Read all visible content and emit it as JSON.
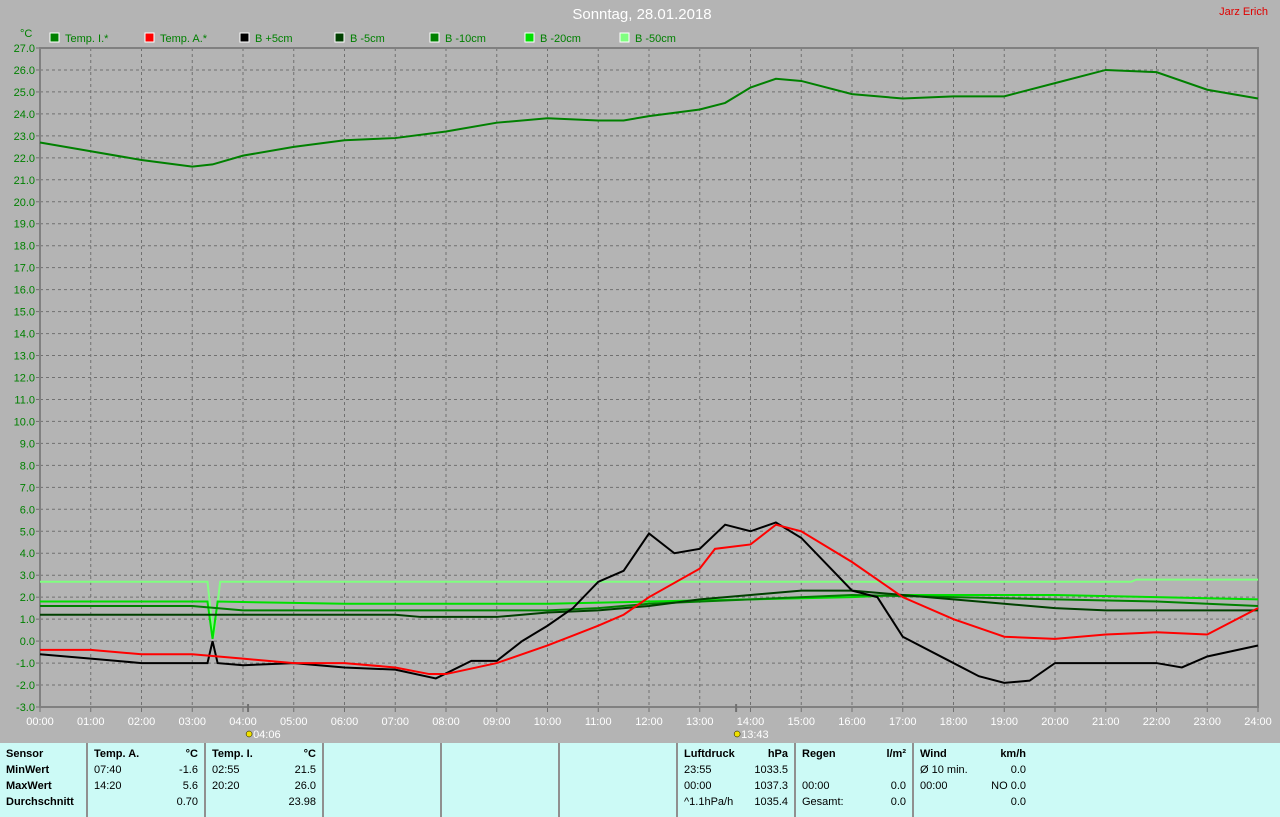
{
  "header": {
    "title": "Sonntag, 28.01.2018",
    "author": "Jarz Erich"
  },
  "chart_data": {
    "type": "line",
    "title": "Sonntag, 28.01.2018",
    "ylabel": "°C",
    "ylim": [
      -3,
      27
    ],
    "xlim": [
      0,
      24
    ],
    "grid": true,
    "legend_position": "top",
    "xticks": [
      "00:00",
      "01:00",
      "02:00",
      "03:00",
      "04:00",
      "05:00",
      "06:00",
      "07:00",
      "08:00",
      "09:00",
      "10:00",
      "11:00",
      "12:00",
      "13:00",
      "14:00",
      "15:00",
      "16:00",
      "17:00",
      "18:00",
      "19:00",
      "20:00",
      "21:00",
      "22:00",
      "23:00",
      "24:00"
    ],
    "yticks": [
      "27.0",
      "26.0",
      "25.0",
      "24.0",
      "23.0",
      "22.0",
      "21.0",
      "20.0",
      "19.0",
      "18.0",
      "17.0",
      "16.0",
      "15.0",
      "14.0",
      "13.0",
      "12.0",
      "11.0",
      "10.0",
      "9.0",
      "8.0",
      "7.0",
      "6.0",
      "5.0",
      "4.0",
      "3.0",
      "2.0",
      "1.0",
      "0.0",
      "-1.0",
      "-2.0",
      "-3.0"
    ],
    "sunrise": "04:06",
    "sunset": "13:43",
    "series": [
      {
        "name": "Temp. I.*",
        "color": "#008000",
        "points": [
          [
            0,
            22.7
          ],
          [
            1,
            22.3
          ],
          [
            2,
            21.9
          ],
          [
            3,
            21.6
          ],
          [
            3.4,
            21.7
          ],
          [
            4,
            22.1
          ],
          [
            5,
            22.5
          ],
          [
            6,
            22.8
          ],
          [
            7,
            22.9
          ],
          [
            8,
            23.2
          ],
          [
            9,
            23.6
          ],
          [
            10,
            23.8
          ],
          [
            11,
            23.7
          ],
          [
            11.5,
            23.7
          ],
          [
            12,
            23.9
          ],
          [
            13,
            24.2
          ],
          [
            13.5,
            24.5
          ],
          [
            14,
            25.2
          ],
          [
            14.5,
            25.6
          ],
          [
            15,
            25.5
          ],
          [
            16,
            24.9
          ],
          [
            17,
            24.7
          ],
          [
            18,
            24.8
          ],
          [
            19,
            24.8
          ],
          [
            20,
            25.4
          ],
          [
            21,
            26.0
          ],
          [
            22,
            25.9
          ],
          [
            23,
            25.1
          ],
          [
            24,
            24.7
          ]
        ]
      },
      {
        "name": "Temp. A.*",
        "color": "#ff0000",
        "points": [
          [
            0,
            -0.4
          ],
          [
            1,
            -0.4
          ],
          [
            2,
            -0.6
          ],
          [
            3,
            -0.6
          ],
          [
            4,
            -0.8
          ],
          [
            5,
            -1.0
          ],
          [
            6,
            -1.0
          ],
          [
            7,
            -1.2
          ],
          [
            7.67,
            -1.5
          ],
          [
            8,
            -1.5
          ],
          [
            9,
            -1.0
          ],
          [
            10,
            -0.2
          ],
          [
            11,
            0.7
          ],
          [
            11.5,
            1.2
          ],
          [
            12,
            2.0
          ],
          [
            13,
            3.3
          ],
          [
            13.3,
            4.2
          ],
          [
            14,
            4.4
          ],
          [
            14.5,
            5.3
          ],
          [
            15,
            5.0
          ],
          [
            16,
            3.6
          ],
          [
            17,
            2.0
          ],
          [
            18,
            1.0
          ],
          [
            19,
            0.2
          ],
          [
            20,
            0.1
          ],
          [
            21,
            0.3
          ],
          [
            22,
            0.4
          ],
          [
            23,
            0.3
          ],
          [
            24,
            1.5
          ]
        ]
      },
      {
        "name": "B +5cm",
        "color": "#000000",
        "points": [
          [
            0,
            -0.6
          ],
          [
            1,
            -0.8
          ],
          [
            2,
            -1.0
          ],
          [
            3,
            -1.0
          ],
          [
            3.3,
            -1.0
          ],
          [
            3.4,
            0.0
          ],
          [
            3.5,
            -1.0
          ],
          [
            4,
            -1.1
          ],
          [
            5,
            -1.0
          ],
          [
            6,
            -1.2
          ],
          [
            7,
            -1.3
          ],
          [
            7.8,
            -1.7
          ],
          [
            8.5,
            -0.9
          ],
          [
            9,
            -0.9
          ],
          [
            9.5,
            0.0
          ],
          [
            10,
            0.7
          ],
          [
            10.5,
            1.5
          ],
          [
            11,
            2.7
          ],
          [
            11.5,
            3.2
          ],
          [
            12,
            4.9
          ],
          [
            12.5,
            4.0
          ],
          [
            13,
            4.2
          ],
          [
            13.5,
            5.3
          ],
          [
            14,
            5.0
          ],
          [
            14.5,
            5.4
          ],
          [
            15,
            4.7
          ],
          [
            15.5,
            3.5
          ],
          [
            16,
            2.3
          ],
          [
            16.5,
            2.0
          ],
          [
            17,
            0.2
          ],
          [
            18,
            -1.0
          ],
          [
            18.5,
            -1.6
          ],
          [
            19,
            -1.9
          ],
          [
            19.5,
            -1.8
          ],
          [
            20,
            -1.0
          ],
          [
            21,
            -1.0
          ],
          [
            22,
            -1.0
          ],
          [
            22.5,
            -1.2
          ],
          [
            23,
            -0.7
          ],
          [
            24,
            -0.2
          ]
        ]
      },
      {
        "name": "B -5cm",
        "color": "#004000",
        "points": [
          [
            0,
            1.2
          ],
          [
            7,
            1.2
          ],
          [
            7.5,
            1.1
          ],
          [
            9,
            1.1
          ],
          [
            10,
            1.3
          ],
          [
            11,
            1.4
          ],
          [
            12,
            1.6
          ],
          [
            13,
            1.9
          ],
          [
            14,
            2.1
          ],
          [
            15,
            2.3
          ],
          [
            16,
            2.3
          ],
          [
            17,
            2.1
          ],
          [
            18,
            1.9
          ],
          [
            19,
            1.7
          ],
          [
            20,
            1.5
          ],
          [
            21,
            1.4
          ],
          [
            24,
            1.4
          ]
        ]
      },
      {
        "name": "B -10cm",
        "color": "#008000",
        "points": [
          [
            0,
            1.6
          ],
          [
            3,
            1.6
          ],
          [
            4,
            1.4
          ],
          [
            10,
            1.4
          ],
          [
            11,
            1.5
          ],
          [
            12,
            1.7
          ],
          [
            14,
            1.9
          ],
          [
            16,
            2.1
          ],
          [
            18,
            2.0
          ],
          [
            20,
            1.9
          ],
          [
            22,
            1.8
          ],
          [
            24,
            1.6
          ]
        ]
      },
      {
        "name": "B -20cm",
        "color": "#00e000",
        "points": [
          [
            0,
            1.8
          ],
          [
            3.3,
            1.8
          ],
          [
            3.4,
            0.1
          ],
          [
            3.5,
            1.8
          ],
          [
            6,
            1.7
          ],
          [
            10,
            1.7
          ],
          [
            12,
            1.8
          ],
          [
            14,
            1.9
          ],
          [
            16,
            2.0
          ],
          [
            17,
            2.1
          ],
          [
            20,
            2.1
          ],
          [
            22,
            2.0
          ],
          [
            24,
            1.9
          ]
        ]
      },
      {
        "name": "B -50cm",
        "color": "#80ff80",
        "points": [
          [
            0,
            2.7
          ],
          [
            3.3,
            2.7
          ],
          [
            3.42,
            0.2
          ],
          [
            3.55,
            2.7
          ],
          [
            21.5,
            2.7
          ],
          [
            21.6,
            2.8
          ],
          [
            24,
            2.8
          ]
        ]
      }
    ]
  },
  "stats": {
    "sensor": {
      "h": "Sensor",
      "min": "MinWert",
      "max": "MaxWert",
      "avg": "Durchschnitt"
    },
    "temp_a": {
      "h": "Temp. A.",
      "u": "°C",
      "min_t": "07:40",
      "min": "-1.6",
      "max_t": "14:20",
      "max": "5.6",
      "avg": "0.70"
    },
    "temp_i": {
      "h": "Temp. I.",
      "u": "°C",
      "min_t": "02:55",
      "min": "21.5",
      "max_t": "20:20",
      "max": "26.0",
      "avg": "23.98"
    },
    "luft": {
      "h": "Luftdruck",
      "u": "hPa",
      "r1a": "23:55",
      "r1b": "1033.5",
      "r2a": "00:00",
      "r2b": "1037.3",
      "r3a": "^1.1hPa/h",
      "r3b": "1035.4"
    },
    "regen": {
      "h": "Regen",
      "u": "l/m²",
      "r2a": "00:00",
      "r2b": "0.0",
      "r3a": "Gesamt:",
      "r3b": "0.0"
    },
    "wind": {
      "h": "Wind",
      "u": "km/h",
      "r1a": "Ø 10 min.",
      "r1b": "0.0",
      "r2a": "00:00",
      "r2b": "NO 0.0",
      "r3b": "0.0"
    }
  }
}
